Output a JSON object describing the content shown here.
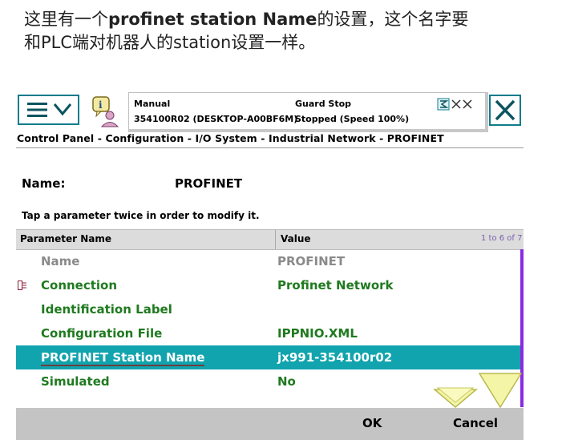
{
  "caption": {
    "line1_pre": "这里有一个",
    "line1_bold": "profinet station Name",
    "line1_post": "的设置，这个名字要",
    "line2": "和PLC端对机器人的station设置一样。"
  },
  "status": {
    "mode": "Manual",
    "controller": "354100R02 (DESKTOP-A00BF6M)",
    "state": "Guard Stop",
    "detail": "Stopped (Speed 100%)"
  },
  "breadcrumb": "Control Panel - Configuration - I/O System - Industrial Network - PROFINET",
  "name": {
    "label": "Name:",
    "value": "PROFINET"
  },
  "hint": "Tap a parameter twice in order to modify it.",
  "table": {
    "col_param": "Parameter Name",
    "col_value": "Value",
    "paging": "1 to 6 of 7",
    "rows": [
      {
        "name": "Name",
        "value": "PROFINET"
      },
      {
        "name": "Connection",
        "value": "Profinet Network"
      },
      {
        "name": "Identification Label",
        "value": ""
      },
      {
        "name": "Configuration File",
        "value": "IPPNIO.XML"
      },
      {
        "name": "PROFINET Station Name",
        "value": "jx991-354100r02"
      },
      {
        "name": "Simulated",
        "value": "No"
      }
    ]
  },
  "buttons": {
    "ok": "OK",
    "cancel": "Cancel"
  },
  "colors": {
    "accent": "#0f7c8c",
    "selected": "#12a4ae",
    "green": "#1f7a1f",
    "scroll": "#8a2be2"
  },
  "icons": [
    "menu-icon",
    "chevron-down-icon",
    "info-user-icon",
    "close-icon",
    "status-icons",
    "connection-icon"
  ]
}
